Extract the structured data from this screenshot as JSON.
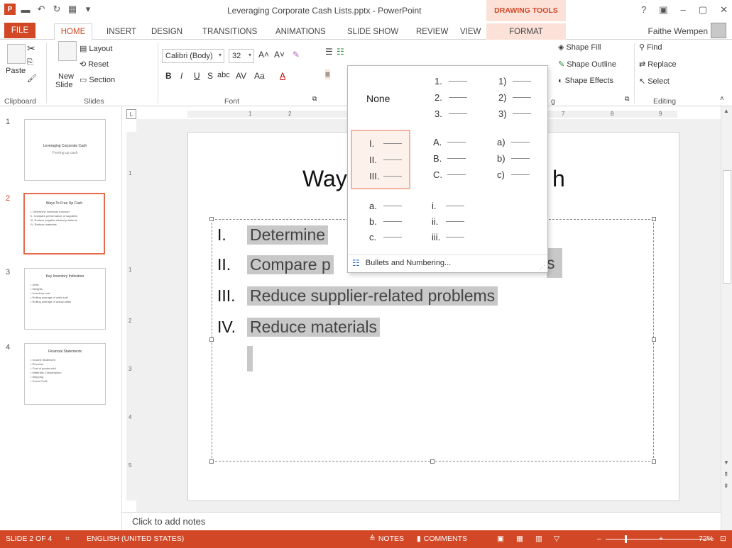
{
  "window": {
    "title": "Leveraging Corporate Cash Lists.pptx - PowerPoint",
    "context_tools": "DRAWING TOOLS",
    "user": "Faithe Wempen",
    "controls": [
      "?",
      "▣",
      "–",
      "▢",
      "✕"
    ]
  },
  "tabs": [
    "FILE",
    "HOME",
    "INSERT",
    "DESIGN",
    "TRANSITIONS",
    "ANIMATIONS",
    "SLIDE SHOW",
    "REVIEW",
    "VIEW",
    "FORMAT"
  ],
  "ribbon": {
    "clipboard": {
      "paste": "Paste",
      "label": "Clipboard"
    },
    "slides": {
      "new_slide": "New",
      "new_slide2": "Slide",
      "layout": "Layout",
      "reset": "Reset",
      "section": "Section",
      "label": "Slides"
    },
    "font": {
      "family": "Calibri (Body)",
      "size": "32",
      "label": "Font"
    },
    "drawing": {
      "fill": "Shape Fill",
      "outline": "Shape Outline",
      "effects": "Shape Effects",
      "label_frag": "g"
    },
    "editing": {
      "find": "Find",
      "replace": "Replace",
      "select": "Select",
      "label": "Editing"
    }
  },
  "thumbnails": [
    {
      "num": "1",
      "title": "Leveraging Corporate Cash",
      "lines": [
        "Freeing up cash"
      ]
    },
    {
      "num": "2",
      "title": "Ways To Free Up Cash",
      "lines": [
        "I.   Determine inventory turnover",
        "II.  Compare performance of suppliers",
        "III. Reduce supplier-related problems",
        "IV.  Reduce materials"
      ]
    },
    {
      "num": "3",
      "title": "Key Inventory Indicators",
      "lines": [
        "• Units",
        "• Weights",
        "• Inventory cost",
        "• Rolling average of units sold",
        "• Rolling average of actual sales"
      ]
    },
    {
      "num": "4",
      "title": "Financial Statements",
      "lines": [
        "• Income Statement",
        "• Revenue",
        "• Cost of goods sold",
        "• Materials Consumption",
        "• Shipping",
        "• Gross Profit"
      ]
    }
  ],
  "slide": {
    "title_start": "Way",
    "title_end": "h",
    "items": [
      {
        "num": "I.",
        "text": "Determine"
      },
      {
        "num": "II.",
        "text": "Compare p"
      },
      {
        "num": "III.",
        "text": "Reduce supplier-related problems"
      },
      {
        "num": "IV.",
        "text": "Reduce materials"
      }
    ],
    "hidden_suffix": "s"
  },
  "numbering_menu": {
    "none_label": "None",
    "options": [
      [
        "1.",
        "2.",
        "3."
      ],
      [
        "1)",
        "2)",
        "3)"
      ],
      [
        "I.",
        "II.",
        "III."
      ],
      [
        "A.",
        "B.",
        "C."
      ],
      [
        "a)",
        "b)",
        "c)"
      ],
      [
        "a.",
        "b.",
        "c."
      ],
      [
        "i.",
        "ii.",
        "iii."
      ]
    ],
    "footer": "Bullets and Numbering..."
  },
  "notes": {
    "placeholder": "Click to add notes"
  },
  "status": {
    "slide": "SLIDE 2 OF 4",
    "language": "ENGLISH (UNITED STATES)",
    "notes": "NOTES",
    "comments": "COMMENTS",
    "zoom": "72%"
  },
  "ruler": {
    "h_ticks": [
      "1",
      "2",
      "7",
      "8",
      "9"
    ],
    "v_ticks": [
      "1",
      "1",
      "2",
      "3",
      "4",
      "5"
    ]
  },
  "colors": {
    "accent": "#d24726",
    "highlight": "#f3b39f"
  }
}
